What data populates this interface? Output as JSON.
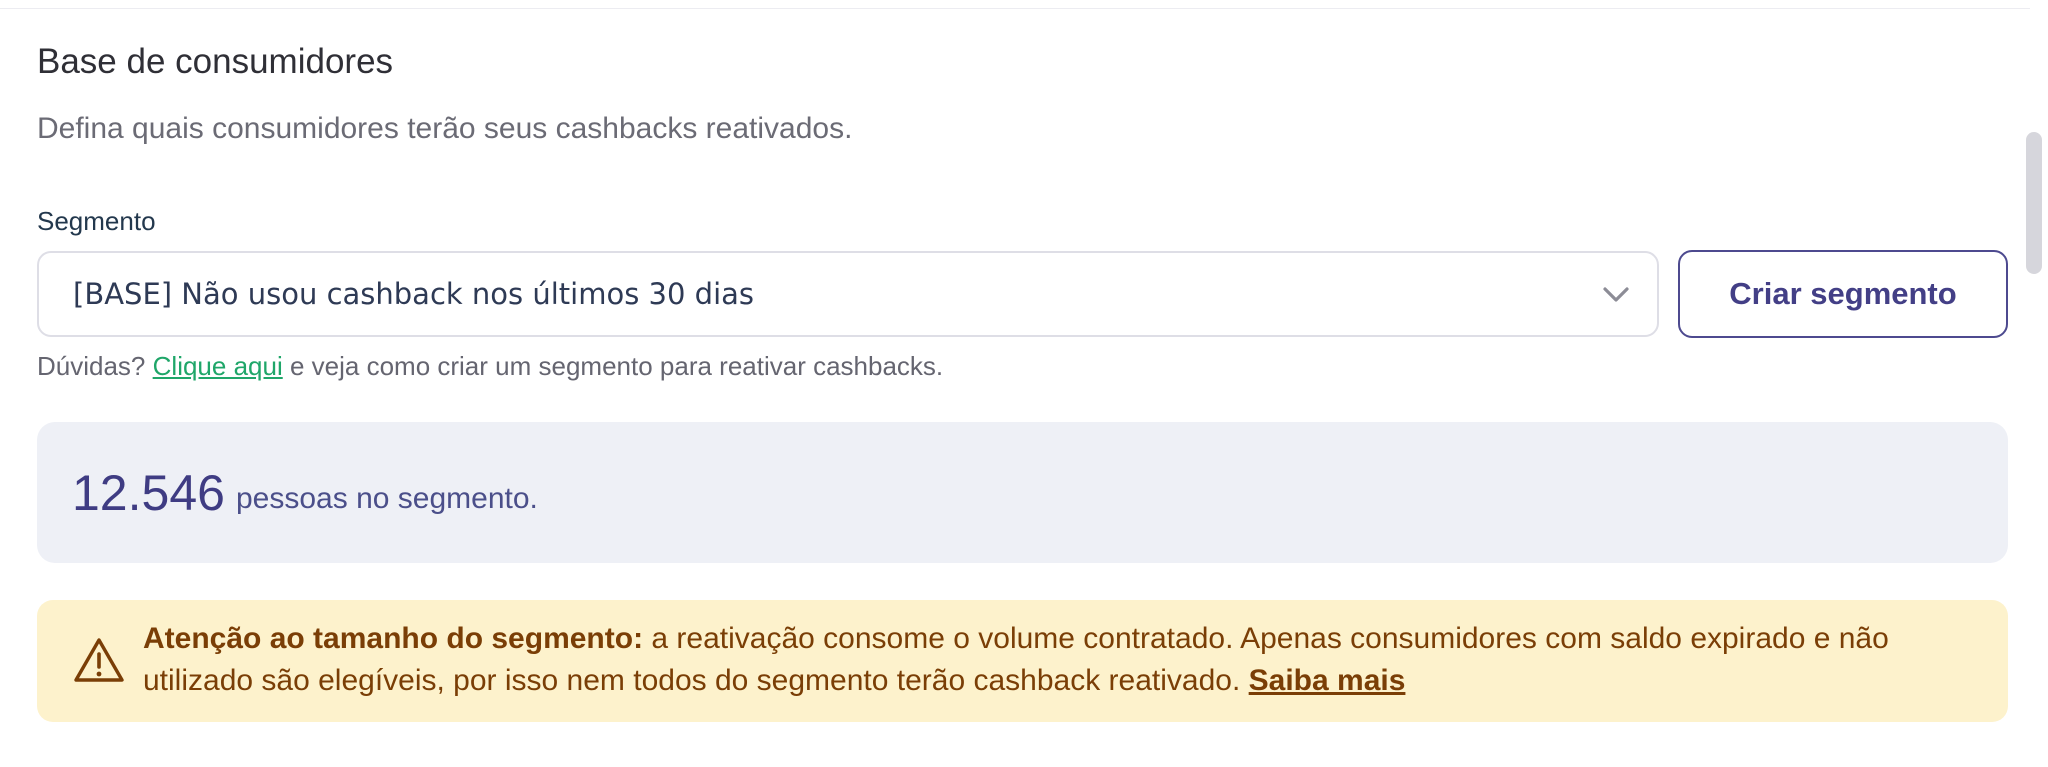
{
  "section": {
    "title": "Base de consumidores",
    "subtitle": "Defina quais consumidores terão seus cashbacks reativados."
  },
  "segment": {
    "label": "Segmento",
    "selected": "[BASE] Não usou cashback nos últimos 30 dias",
    "create_button": "Criar segmento",
    "chevron_icon": "chevron-down-icon"
  },
  "help": {
    "prefix": "Dúvidas?",
    "link": "Clique aqui",
    "suffix": "e veja como criar um segmento para reativar cashbacks."
  },
  "audience": {
    "count": "12.546",
    "label": "pessoas no segmento."
  },
  "warning": {
    "icon": "warning-triangle-icon",
    "heading": "Atenção ao tamanho do segmento:",
    "body": "a reativação consome o volume contratado. Apenas consumidores com saldo expirado e não utilizado são elegíveis, por isso nem todos do segmento terão cashback reativado.",
    "link": "Saiba mais"
  },
  "colors": {
    "accent": "#433f86",
    "link_green": "#1fa669",
    "warning_bg": "#fdf2cc",
    "warning_text": "#7a3e06",
    "count_bg": "#eef0f6"
  }
}
